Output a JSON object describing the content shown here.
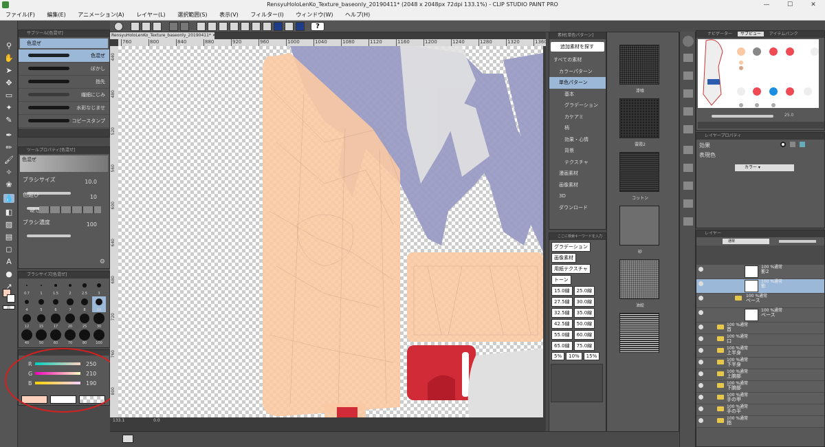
{
  "window": {
    "title": "RensyuHoloLenKo_Texture_baseonly_20190411* (2048 x 2048px 72dpi 133.1%)  - CLIP STUDIO PAINT PRO",
    "controls": [
      "—",
      "☐",
      "✕"
    ]
  },
  "menu": [
    "ファイル(F)",
    "編集(E)",
    "アニメーション(A)",
    "レイヤー(L)",
    "選択範囲(S)",
    "表示(V)",
    "フィルター(I)",
    "ウィンドウ(W)",
    "ヘルプ(H)"
  ],
  "doc_tab": {
    "label": "RensyuHoloLenKo_Texture_baseonly_20190411*"
  },
  "subtool_panel": {
    "title": "サブツール[色混ぜ]",
    "group": "色混ぜ",
    "brushes": [
      "色混ぜ",
      "ぼかし",
      "指先",
      "繊細にじみ",
      "水彩なじませ",
      "コピースタンプ"
    ]
  },
  "tool_property": {
    "title": "ツールプロパティ[色混ぜ]",
    "name": "色混ぜ",
    "brush_size_label": "ブラシサイズ",
    "brush_size": "10.0",
    "color_stretch_label": "色延び",
    "color_stretch": "10",
    "hardness_label": "硬さ",
    "density_label": "ブラシ濃度",
    "density": "100"
  },
  "brush_size_panel": {
    "title": "ブラシサイズ[色混ぜ]",
    "sizes": [
      "0.7",
      "1",
      "1.5",
      "2",
      "2.5",
      "3",
      "4",
      "5",
      "6",
      "7",
      "8",
      "10",
      "12",
      "15",
      "17",
      "20",
      "25",
      "30",
      "40",
      "50",
      "60",
      "70",
      "80",
      "100"
    ]
  },
  "color_panel": {
    "r_label": "R",
    "r": "250",
    "g_label": "G",
    "g": "210",
    "b_label": "B",
    "b": "190"
  },
  "ruler_top": [
    "760",
    "800",
    "840",
    "880",
    "920",
    "960",
    "1000",
    "1040",
    "1080",
    "1120",
    "1160",
    "1200",
    "1240",
    "1280",
    "1320",
    "1360"
  ],
  "ruler_left": [
    "440",
    "480",
    "520",
    "560",
    "600",
    "640",
    "680",
    "720",
    "760",
    "800"
  ],
  "canvas_footer": {
    "zoom": "133.1",
    "pos": "0.0"
  },
  "material_panel": {
    "title": "素材[単色パターン]",
    "add_label": "追加素材を探す",
    "tree": [
      "すべての素材",
      "カラーパターン",
      "単色パターン",
      "基本",
      "グラデーション",
      "カケアミ",
      "柄",
      "効果・心情",
      "背景",
      "テクスチャ",
      "漫画素材",
      "画像素材",
      "3D",
      "ダウンロード"
    ],
    "search_placeholder": "ここに検索キーワードを入力",
    "tags": [
      "グラデーション",
      "画像素材",
      "用紙テクスチャ",
      "トーン",
      "15.0線",
      "25.0線",
      "27.5線",
      "30.0線",
      "32.5線",
      "35.0線",
      "42.5線",
      "50.0線",
      "55.0線",
      "60.0線",
      "65.0線",
      "75.0線",
      "5%",
      "10%",
      "15%"
    ],
    "thumbs": [
      "漆喰",
      "雲霞2",
      "コットン",
      "砂",
      "油絵",
      ""
    ]
  },
  "subview_panel": {
    "tabs": [
      "ナビゲーター",
      "サブビュー",
      "アイテムバンク"
    ],
    "zoom": "25.0"
  },
  "effect_panel": {
    "title": "レイヤープロパティ",
    "effect_label": "効果",
    "express_label": "表現色",
    "express_value": "カラー"
  },
  "layer_panel": {
    "title": "レイヤー",
    "blend": "通常",
    "layers": [
      {
        "name": "100 %通常",
        "sub": "影2",
        "type": "raster"
      },
      {
        "name": "100 %通常",
        "sub": "影",
        "type": "raster",
        "selected": true
      },
      {
        "name": "100 %通常",
        "sub": "ベース",
        "type": "folder"
      },
      {
        "name": "100 %通常",
        "sub": "ベース",
        "type": "raster"
      },
      {
        "name": "100 %通常",
        "sub": "首",
        "type": "folder"
      },
      {
        "name": "100 %通常",
        "sub": "口",
        "type": "folder"
      },
      {
        "name": "100 %通常",
        "sub": "上半身",
        "type": "folder"
      },
      {
        "name": "100 %通常",
        "sub": "下半身",
        "type": "folder"
      },
      {
        "name": "100 %通常",
        "sub": "上腕部",
        "type": "folder"
      },
      {
        "name": "100 %通常",
        "sub": "下腕部",
        "type": "folder"
      },
      {
        "name": "100 %通常",
        "sub": "手の甲",
        "type": "folder"
      },
      {
        "name": "100 %通常",
        "sub": "手の平",
        "type": "folder"
      },
      {
        "name": "100 %通常",
        "sub": "指",
        "type": "folder"
      }
    ]
  },
  "colors": {
    "main": "#fad2be",
    "sub": "#ffffff",
    "peach": "#fbc9a3",
    "lavender": "#9b9cc5",
    "red": "#d22b38",
    "accent": "#4a90c8"
  }
}
